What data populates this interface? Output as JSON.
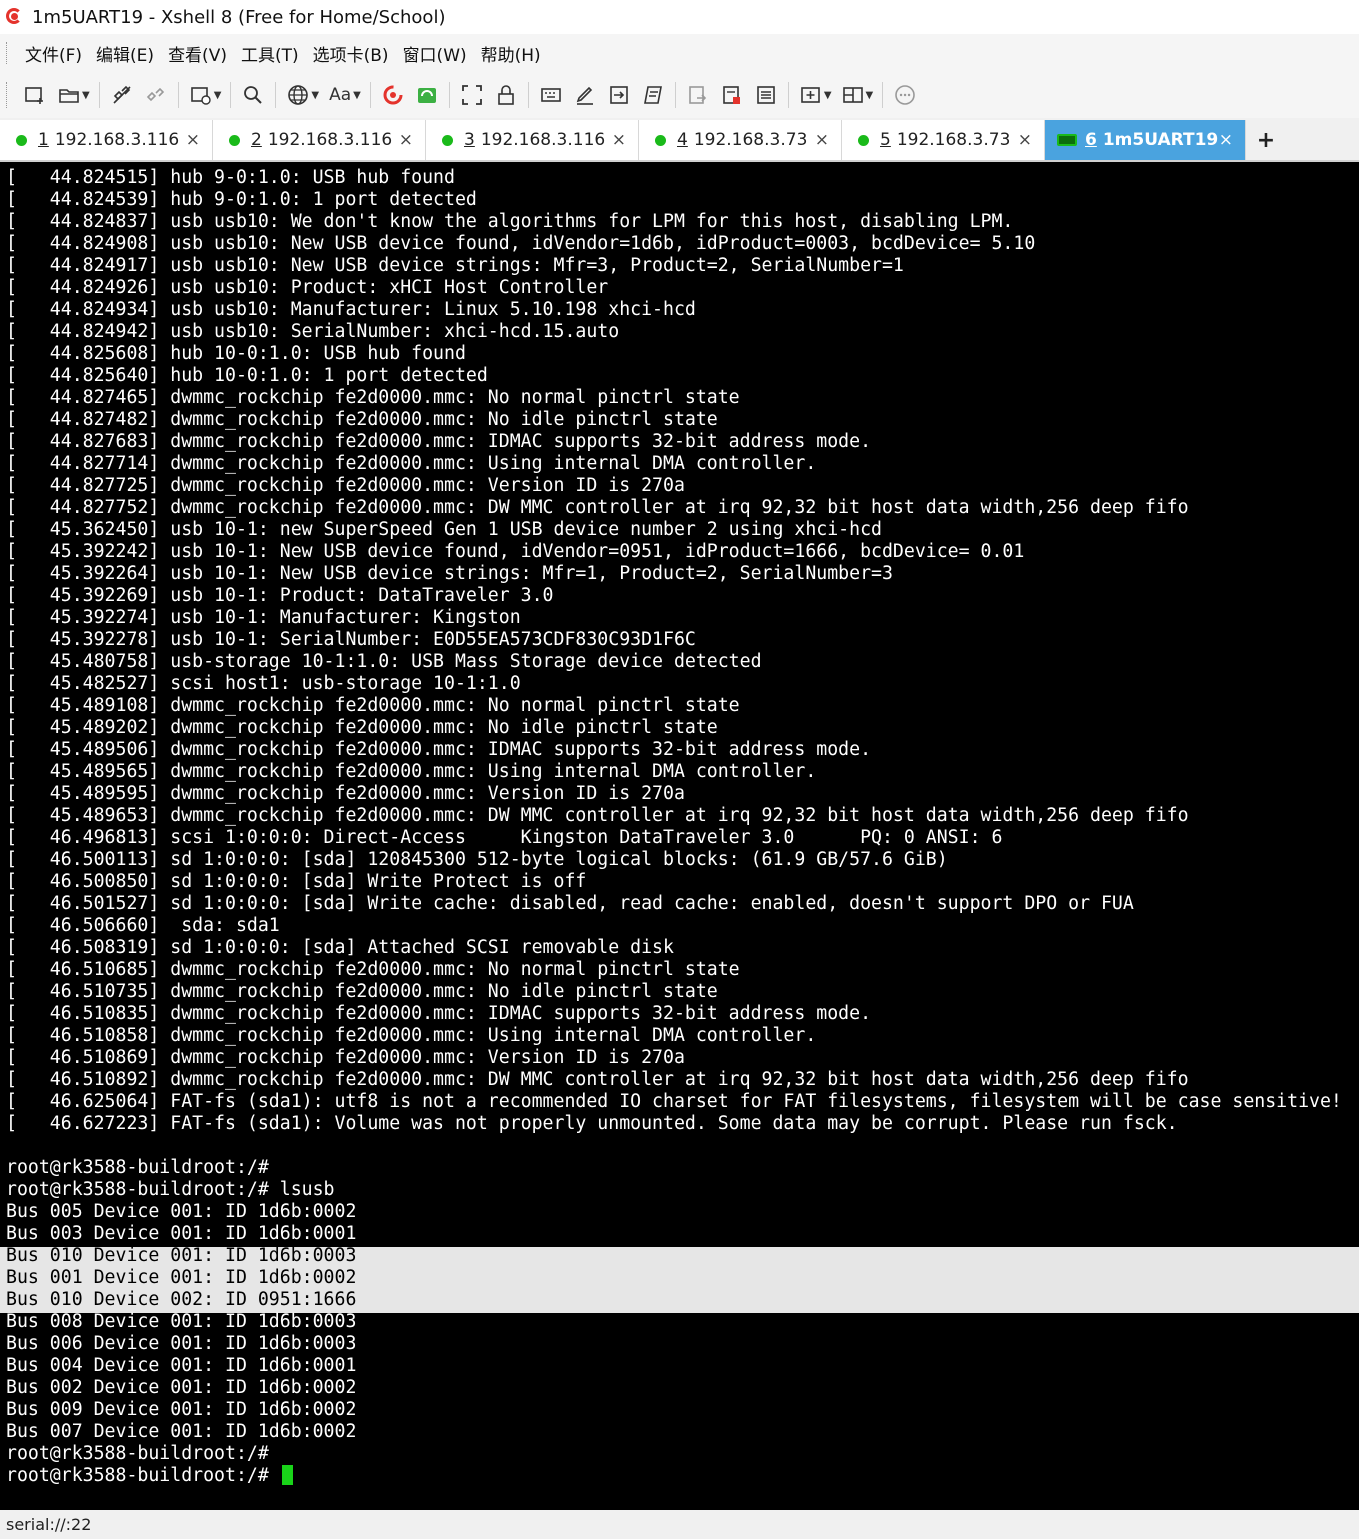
{
  "window": {
    "title": "1m5UART19 - Xshell 8 (Free for Home/School)"
  },
  "menu": [
    "文件(F)",
    "编辑(E)",
    "查看(V)",
    "工具(T)",
    "选项卡(B)",
    "窗口(W)",
    "帮助(H)"
  ],
  "toolbar": {
    "font_label": "Aa"
  },
  "tabs": [
    {
      "num": "1",
      "label": "192.168.3.116",
      "active": false
    },
    {
      "num": "2",
      "label": "192.168.3.116",
      "active": false
    },
    {
      "num": "3",
      "label": "192.168.3.116",
      "active": false
    },
    {
      "num": "4",
      "label": "192.168.3.73",
      "active": false
    },
    {
      "num": "5",
      "label": "192.168.3.73",
      "active": false
    },
    {
      "num": "6",
      "label": "1m5UART19",
      "active": true
    }
  ],
  "tab_close_glyph": "×",
  "new_tab_glyph": "+",
  "terminal": {
    "lines": [
      "[   44.824515] hub 9-0:1.0: USB hub found",
      "[   44.824539] hub 9-0:1.0: 1 port detected",
      "[   44.824837] usb usb10: We don't know the algorithms for LPM for this host, disabling LPM.",
      "[   44.824908] usb usb10: New USB device found, idVendor=1d6b, idProduct=0003, bcdDevice= 5.10",
      "[   44.824917] usb usb10: New USB device strings: Mfr=3, Product=2, SerialNumber=1",
      "[   44.824926] usb usb10: Product: xHCI Host Controller",
      "[   44.824934] usb usb10: Manufacturer: Linux 5.10.198 xhci-hcd",
      "[   44.824942] usb usb10: SerialNumber: xhci-hcd.15.auto",
      "[   44.825608] hub 10-0:1.0: USB hub found",
      "[   44.825640] hub 10-0:1.0: 1 port detected",
      "[   44.827465] dwmmc_rockchip fe2d0000.mmc: No normal pinctrl state",
      "[   44.827482] dwmmc_rockchip fe2d0000.mmc: No idle pinctrl state",
      "[   44.827683] dwmmc_rockchip fe2d0000.mmc: IDMAC supports 32-bit address mode.",
      "[   44.827714] dwmmc_rockchip fe2d0000.mmc: Using internal DMA controller.",
      "[   44.827725] dwmmc_rockchip fe2d0000.mmc: Version ID is 270a",
      "[   44.827752] dwmmc_rockchip fe2d0000.mmc: DW MMC controller at irq 92,32 bit host data width,256 deep fifo",
      "[   45.362450] usb 10-1: new SuperSpeed Gen 1 USB device number 2 using xhci-hcd",
      "[   45.392242] usb 10-1: New USB device found, idVendor=0951, idProduct=1666, bcdDevice= 0.01",
      "[   45.392264] usb 10-1: New USB device strings: Mfr=1, Product=2, SerialNumber=3",
      "[   45.392269] usb 10-1: Product: DataTraveler 3.0",
      "[   45.392274] usb 10-1: Manufacturer: Kingston",
      "[   45.392278] usb 10-1: SerialNumber: E0D55EA573CDF830C93D1F6C",
      "[   45.480758] usb-storage 10-1:1.0: USB Mass Storage device detected",
      "[   45.482527] scsi host1: usb-storage 10-1:1.0",
      "[   45.489108] dwmmc_rockchip fe2d0000.mmc: No normal pinctrl state",
      "[   45.489202] dwmmc_rockchip fe2d0000.mmc: No idle pinctrl state",
      "[   45.489506] dwmmc_rockchip fe2d0000.mmc: IDMAC supports 32-bit address mode.",
      "[   45.489565] dwmmc_rockchip fe2d0000.mmc: Using internal DMA controller.",
      "[   45.489595] dwmmc_rockchip fe2d0000.mmc: Version ID is 270a",
      "[   45.489653] dwmmc_rockchip fe2d0000.mmc: DW MMC controller at irq 92,32 bit host data width,256 deep fifo",
      "[   46.496813] scsi 1:0:0:0: Direct-Access     Kingston DataTraveler 3.0      PQ: 0 ANSI: 6",
      "[   46.500113] sd 1:0:0:0: [sda] 120845300 512-byte logical blocks: (61.9 GB/57.6 GiB)",
      "[   46.500850] sd 1:0:0:0: [sda] Write Protect is off",
      "[   46.501527] sd 1:0:0:0: [sda] Write cache: disabled, read cache: enabled, doesn't support DPO or FUA",
      "[   46.506660]  sda: sda1",
      "[   46.508319] sd 1:0:0:0: [sda] Attached SCSI removable disk",
      "[   46.510685] dwmmc_rockchip fe2d0000.mmc: No normal pinctrl state",
      "[   46.510735] dwmmc_rockchip fe2d0000.mmc: No idle pinctrl state",
      "[   46.510835] dwmmc_rockchip fe2d0000.mmc: IDMAC supports 32-bit address mode.",
      "[   46.510858] dwmmc_rockchip fe2d0000.mmc: Using internal DMA controller.",
      "[   46.510869] dwmmc_rockchip fe2d0000.mmc: Version ID is 270a",
      "[   46.510892] dwmmc_rockchip fe2d0000.mmc: DW MMC controller at irq 92,32 bit host data width,256 deep fifo",
      "[   46.625064] FAT-fs (sda1): utf8 is not a recommended IO charset for FAT filesystems, filesystem will be case sensitive!",
      "[   46.627223] FAT-fs (sda1): Volume was not properly unmounted. Some data may be corrupt. Please run fsck.",
      "",
      "root@rk3588-buildroot:/#",
      "root@rk3588-buildroot:/# lsusb",
      "Bus 005 Device 001: ID 1d6b:0002",
      "Bus 003 Device 001: ID 1d6b:0001",
      "Bus 010 Device 001: ID 1d6b:0003",
      "Bus 001 Device 001: ID 1d6b:0002",
      "Bus 010 Device 002: ID 0951:1666",
      "Bus 008 Device 001: ID 1d6b:0003",
      "Bus 006 Device 001: ID 1d6b:0003",
      "Bus 004 Device 001: ID 1d6b:0001",
      "Bus 002 Device 001: ID 1d6b:0002",
      "Bus 009 Device 001: ID 1d6b:0002",
      "Bus 007 Device 001: ID 1d6b:0002",
      "root@rk3588-buildroot:/#",
      "root@rk3588-buildroot:/# "
    ],
    "selected_lines": [
      49,
      50,
      51
    ],
    "cursor_color": "#19d419"
  },
  "status": {
    "text": "serial://:22"
  },
  "colors": {
    "active_tab": "#4aa3df",
    "connected_dot": "#1aba1a",
    "terminal_bg": "#000000",
    "terminal_fg": "#ffffff"
  }
}
